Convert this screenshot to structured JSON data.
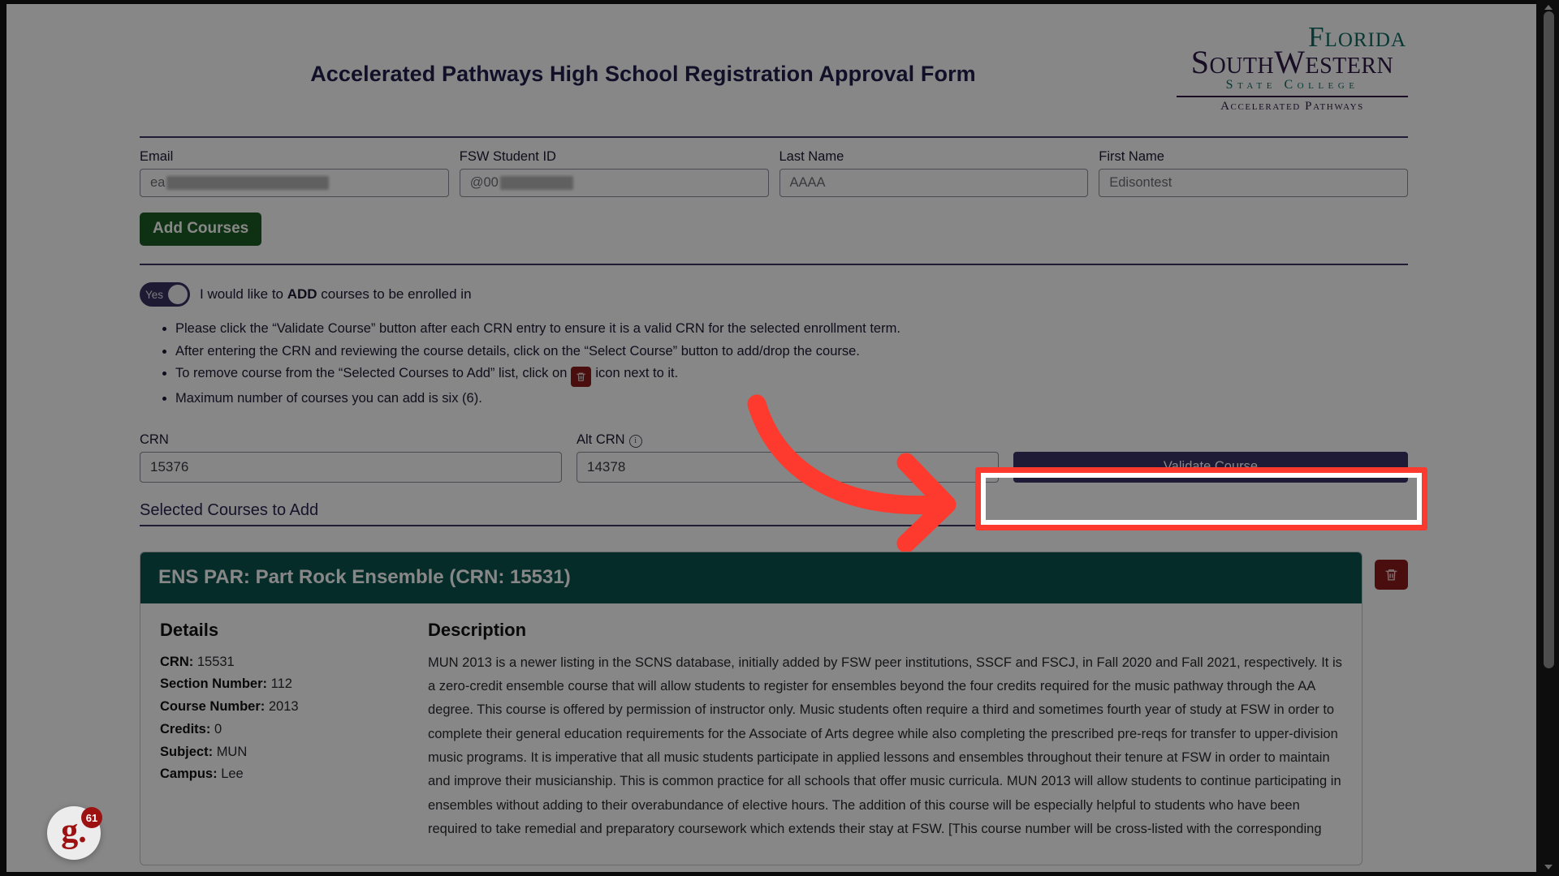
{
  "header": {
    "form_title": "Accelerated Pathways High School Registration Approval Form",
    "logo": {
      "line1": "Florida",
      "line2": "SouthWestern",
      "line3": "State College",
      "line4": "Accelerated Pathways"
    }
  },
  "student_fields": [
    {
      "label": "Email",
      "value": "ea",
      "redacted": true
    },
    {
      "label": "FSW Student ID",
      "value": "@00",
      "redacted": true
    },
    {
      "label": "Last Name",
      "value": "AAAA",
      "redacted": false
    },
    {
      "label": "First Name",
      "value": "Edisontest",
      "redacted": false
    }
  ],
  "buttons": {
    "add_courses": "Add Courses",
    "validate_course": "Validate Course"
  },
  "toggle": {
    "state_label": "Yes",
    "description_prefix": "I would like to ",
    "description_emphasis": "ADD",
    "description_suffix": " courses to be enrolled in"
  },
  "instructions": [
    {
      "pre": "Please click the “Validate Course” button after each CRN entry to ensure it is a valid CRN for the selected enrollment term.",
      "icon": false,
      "post": ""
    },
    {
      "pre": "After entering the CRN and reviewing the course details, click on the “Select Course” button to add/drop the course.",
      "icon": false,
      "post": ""
    },
    {
      "pre": "To remove course from the “Selected Courses to Add” list, click on",
      "icon": true,
      "post": "icon next to it."
    },
    {
      "pre": "Maximum number of courses you can add is six (6).",
      "icon": false,
      "post": ""
    }
  ],
  "crn_section": {
    "crn_label": "CRN",
    "crn_value": "15376",
    "alt_crn_label": "Alt CRN",
    "alt_crn_info_icon": "info-icon",
    "alt_crn_value": "14378"
  },
  "selected_courses": {
    "section_title": "Selected Courses to Add",
    "course": {
      "header": "ENS PAR: Part Rock Ensemble  (CRN: 15531)",
      "details_heading": "Details",
      "details": [
        {
          "label": "CRN:",
          "value": "15531"
        },
        {
          "label": "Section Number:",
          "value": "112"
        },
        {
          "label": "Course Number:",
          "value": "2013"
        },
        {
          "label": "Credits:",
          "value": "0"
        },
        {
          "label": "Subject:",
          "value": "MUN"
        },
        {
          "label": "Campus:",
          "value": "Lee"
        }
      ],
      "description_heading": "Description",
      "description": "MUN 2013 is a newer listing in the SCNS database, initially added by FSW peer institutions, SSCF and FSCJ, in Fall 2020 and Fall 2021, respectively. It is a zero-credit ensemble course that will allow students to register for ensembles beyond the four credits required for the music pathway through the AA degree. This course is offered by permission of instructor only. Music students often require a third and sometimes fourth year of study at FSW in order to complete their general education requirements for the Associate of Arts degree while also completing the prescribed pre-reqs for transfer to upper-division music programs. It is imperative that all music students participate in applied lessons and ensembles throughout their tenure at FSW in order to maintain and improve their musicianship. This is common practice for all schools that offer music curricula. MUN 2013 will allow students to continue participating in ensembles without adding to their overabundance of elective hours. The addition of this course will be especially helpful to students who have been required to take remedial and preparatory coursework which extends their stay at FSW. [This course number will be cross-listed with the corresponding"
    }
  },
  "floating_badge": {
    "glyph": "g.",
    "count": "61"
  },
  "colors": {
    "accent_purple": "#3b3166",
    "teal": "#0b544f",
    "green": "#1d5d24",
    "red": "#8e1b1b",
    "annotation_red": "#fd3a2d"
  }
}
